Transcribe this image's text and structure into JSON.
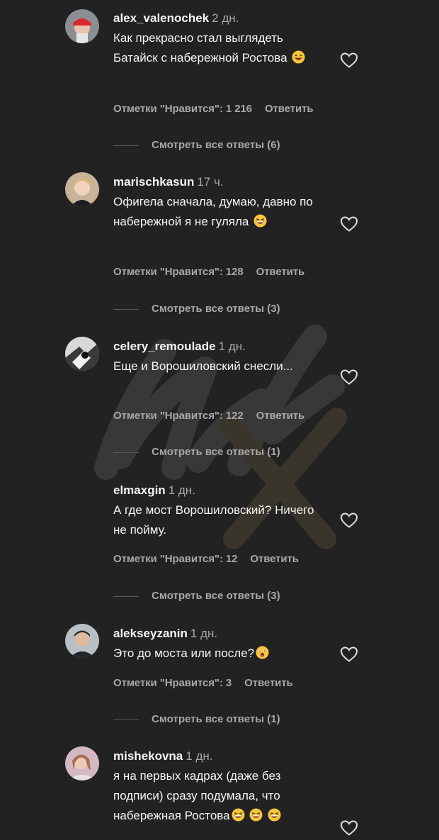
{
  "comments": [
    {
      "username": "alex_valenochek",
      "time": "2 дн.",
      "text": "Как прекрасно стал выглядеть Батайск с набережной Ростова",
      "emoji_count": 1,
      "likes": "Отметки \"Нравится\": 1 216",
      "reply_label": "Ответить",
      "view_replies": "Смотреть все ответы (6)",
      "avatar": "avatar-red-cap"
    },
    {
      "username": "marischkasun",
      "time": "17 ч.",
      "text": "Офигела сначала, думаю, давно по набережной я не гуляла",
      "emoji_count": 1,
      "likes": "Отметки \"Нравится\": 128",
      "reply_label": "Ответить",
      "view_replies": "Смотреть все ответы (3)",
      "avatar": "avatar-woman-blonde"
    },
    {
      "username": "celery_remoulade",
      "time": "1 дн.",
      "text": "Еще и Ворошиловский снесли...",
      "emoji_count": 0,
      "likes": "Отметки \"Нравится\": 122",
      "reply_label": "Ответить",
      "view_replies": "Смотреть все ответы (1)",
      "avatar": "avatar-monochrome"
    },
    {
      "username": "elmaxgin",
      "time": "1 дн.",
      "text": "А где мост Ворошиловский? Ничего не пойму.",
      "emoji_count": 0,
      "likes": "Отметки \"Нравится\": 12",
      "reply_label": "Ответить",
      "view_replies": "Смотреть все ответы (3)",
      "avatar": "avatar-dark"
    },
    {
      "username": "alekseyzanin",
      "time": "1 дн.",
      "text": "Это до моста или после?",
      "emoji_count": 1,
      "likes": "Отметки \"Нравится\": 3",
      "reply_label": "Ответить",
      "view_replies": "Смотреть все ответы (1)",
      "avatar": "avatar-man"
    },
    {
      "username": "mishekovna",
      "time": "1 дн.",
      "text": "я на первых кадрах (даже без подписи) сразу подумала, что набережная Ростова",
      "emoji_count": 3,
      "likes": "",
      "reply_label": "",
      "view_replies": "",
      "avatar": "avatar-pink"
    }
  ],
  "colors": {
    "background": "#222223",
    "primary_text": "#f5f5f5",
    "secondary_text": "#a8a8a8",
    "emoji": "#f7c53b"
  }
}
